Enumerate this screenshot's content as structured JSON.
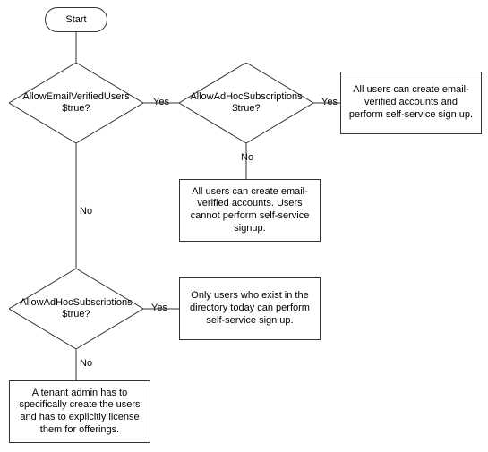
{
  "diagram": {
    "type": "flowchart",
    "start_label": "Start",
    "d1_label": "AllowEmailVerifiedUsers $true?",
    "d2_label": "AllowAdHocSubscriptions $true?",
    "d3_label": "AllowAdHocSubscriptions $true?",
    "box1_text": "All users can create email-verified accounts and perform self-service sign up.",
    "box2_text": "All users can create email-verified accounts. Users cannot perform self-service signup.",
    "box3_text": "Only users who exist in the directory today can perform self-service sign up.",
    "box4_text": "A tenant admin has to specifically create the users and has to explicitly license them for offerings.",
    "yes": "Yes",
    "no": "No"
  }
}
